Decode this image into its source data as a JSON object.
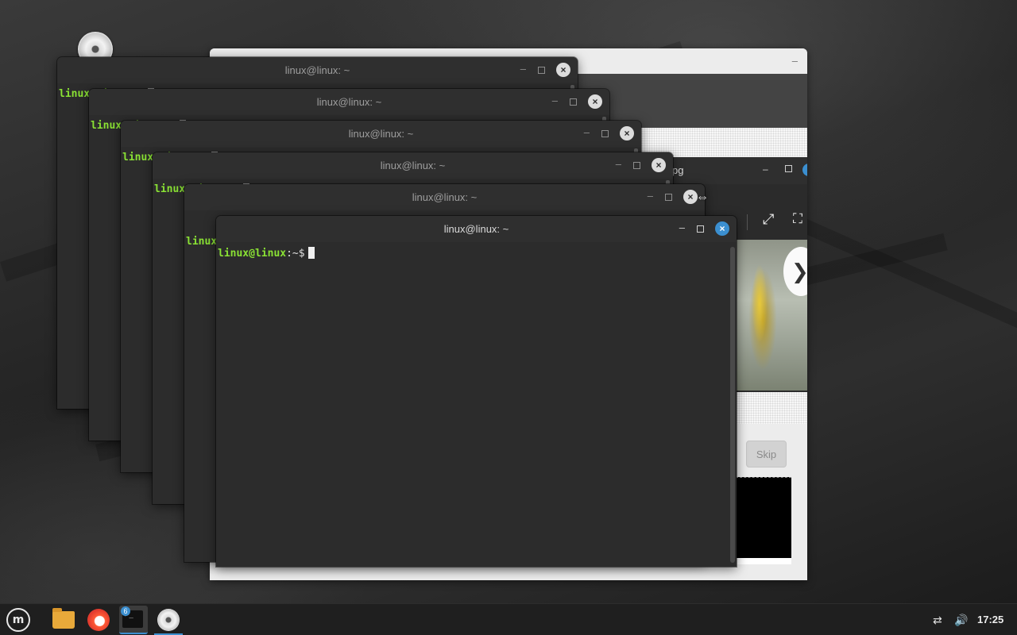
{
  "terminal": {
    "window_title": "linux@linux: ~",
    "prompt_user": "linux@linux",
    "prompt_suffix": ":~$",
    "minimize_label": "–",
    "close_label": "×"
  },
  "welcome_window": {
    "skip_label": "Skip",
    "minimize_label": "–"
  },
  "image_viewer": {
    "title_fragment": "pg",
    "next_label": "❯"
  },
  "taskbar": {
    "menu_label": "m",
    "terminal_count": "6",
    "terminal_glyph": ">_",
    "clock": "17:25",
    "accent_color": "#3b8fd0"
  }
}
